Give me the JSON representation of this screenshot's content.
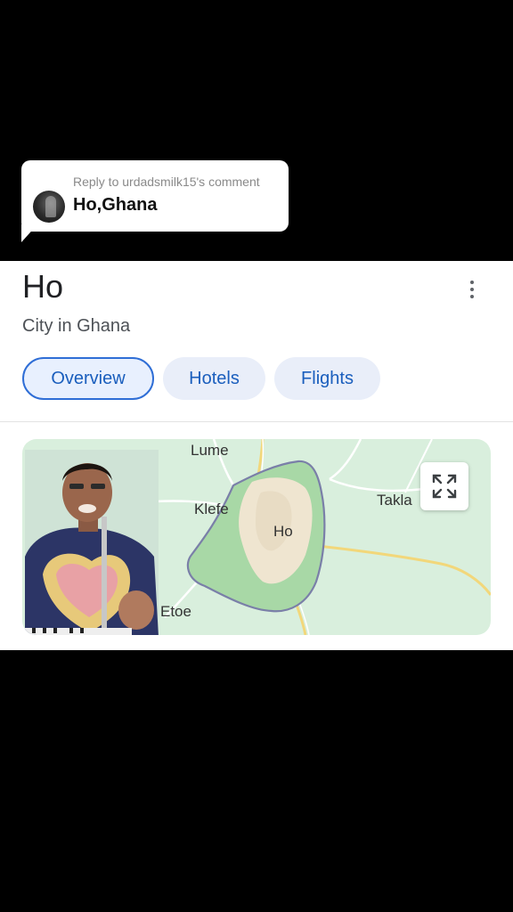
{
  "reply": {
    "title": "Reply to urdadsmilk15's comment",
    "text": "Ho,Ghana"
  },
  "place": {
    "name": "Ho",
    "description": "City in Ghana"
  },
  "tabs": [
    {
      "label": "Overview",
      "active": true
    },
    {
      "label": "Hotels",
      "active": false
    },
    {
      "label": "Flights",
      "active": false
    }
  ],
  "map": {
    "labels": {
      "lume": "Lume",
      "klefe": "Klefe",
      "ho": "Ho",
      "takla": "Takla",
      "etoe": "Etoe"
    }
  },
  "colors": {
    "accent": "#1a5ebd",
    "chip_bg": "#e8f0fe",
    "map_green": "#d9efdd"
  },
  "icons": {
    "menu": "more-vert-icon",
    "expand": "fullscreen-icon"
  }
}
